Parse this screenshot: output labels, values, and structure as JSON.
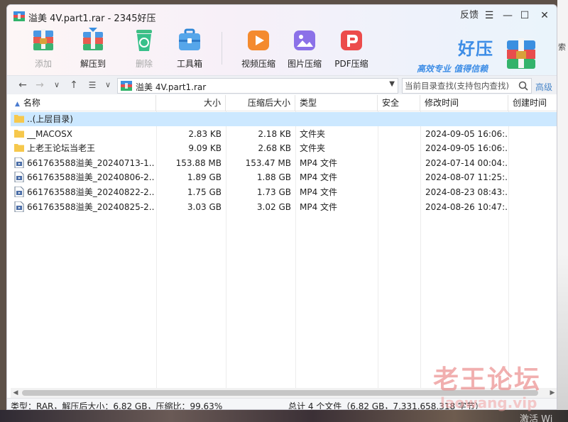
{
  "window": {
    "title": "溢美 4V.part1.rar - 2345好压",
    "controls": {
      "feedback": "反馈",
      "menu": "☰",
      "minimize": "—",
      "maximize": "☐",
      "close": "✕"
    }
  },
  "toolbar": {
    "items": [
      {
        "label": "添加",
        "icon": "add-archive-icon",
        "enabled": false
      },
      {
        "label": "解压到",
        "icon": "extract-to-icon",
        "enabled": true
      },
      {
        "label": "删除",
        "icon": "delete-recycle-icon",
        "enabled": false
      },
      {
        "label": "工具箱",
        "icon": "toolbox-icon",
        "enabled": true
      },
      {
        "label": "视频压缩",
        "icon": "video-compress-icon",
        "enabled": true
      },
      {
        "label": "图片压缩",
        "icon": "image-compress-icon",
        "enabled": true
      },
      {
        "label": "PDF压缩",
        "icon": "pdf-compress-icon",
        "enabled": true
      }
    ]
  },
  "brand": {
    "name": "好压",
    "slogan": "高效专业  值得信赖"
  },
  "address_bar": {
    "path": "溢美 4V.part1.rar",
    "search_placeholder": "当前目录查找(支持包内查找)",
    "advanced": "高级"
  },
  "file_list": {
    "columns": [
      "名称",
      "大小",
      "压缩后大小",
      "类型",
      "安全",
      "修改时间",
      "创建时间"
    ],
    "rows": [
      {
        "name": "..(上层目录)",
        "size": "",
        "packed": "",
        "type": "",
        "security": "",
        "modified": "",
        "created": "",
        "kind": "parent",
        "selected": true
      },
      {
        "name": "__MACOSX",
        "size": "2.83 KB",
        "packed": "2.18 KB",
        "type": "文件夹",
        "security": "",
        "modified": "2024-09-05 16:06:...",
        "created": "",
        "kind": "folder",
        "selected": false
      },
      {
        "name": "上老王论坛当老王",
        "size": "9.09 KB",
        "packed": "2.68 KB",
        "type": "文件夹",
        "security": "",
        "modified": "2024-09-05 16:06:...",
        "created": "",
        "kind": "folder",
        "selected": false
      },
      {
        "name": "661763588溢美_20240713-1...",
        "size": "153.88 MB",
        "packed": "153.47 MB",
        "type": "MP4 文件",
        "security": "",
        "modified": "2024-07-14 00:04:...",
        "created": "",
        "kind": "video",
        "selected": false
      },
      {
        "name": "661763588溢美_20240806-2...",
        "size": "1.89 GB",
        "packed": "1.88 GB",
        "type": "MP4 文件",
        "security": "",
        "modified": "2024-08-07 11:25:...",
        "created": "",
        "kind": "video",
        "selected": false
      },
      {
        "name": "661763588溢美_20240822-2...",
        "size": "1.75 GB",
        "packed": "1.73 GB",
        "type": "MP4 文件",
        "security": "",
        "modified": "2024-08-23 08:43:...",
        "created": "",
        "kind": "video",
        "selected": false
      },
      {
        "name": "661763588溢美_20240825-2...",
        "size": "3.03 GB",
        "packed": "3.02 GB",
        "type": "MP4 文件",
        "security": "",
        "modified": "2024-08-26 10:47:...",
        "created": "",
        "kind": "video",
        "selected": false
      }
    ]
  },
  "status_bar": {
    "left": "类型：RAR，解压后大小：6.82 GB，压缩比：99.63%",
    "right": "总计 4 个文件（6.82 GB，7,331,658,318 字节）"
  },
  "overlay": {
    "watermark_cn": "老王论坛",
    "watermark_url": "laowang.vip",
    "activate": "激活 Wi",
    "desktop_right": "索"
  },
  "colors": {
    "accent": "#3d8de6",
    "selection": "#cce8ff",
    "folder": "#f6c84c"
  }
}
